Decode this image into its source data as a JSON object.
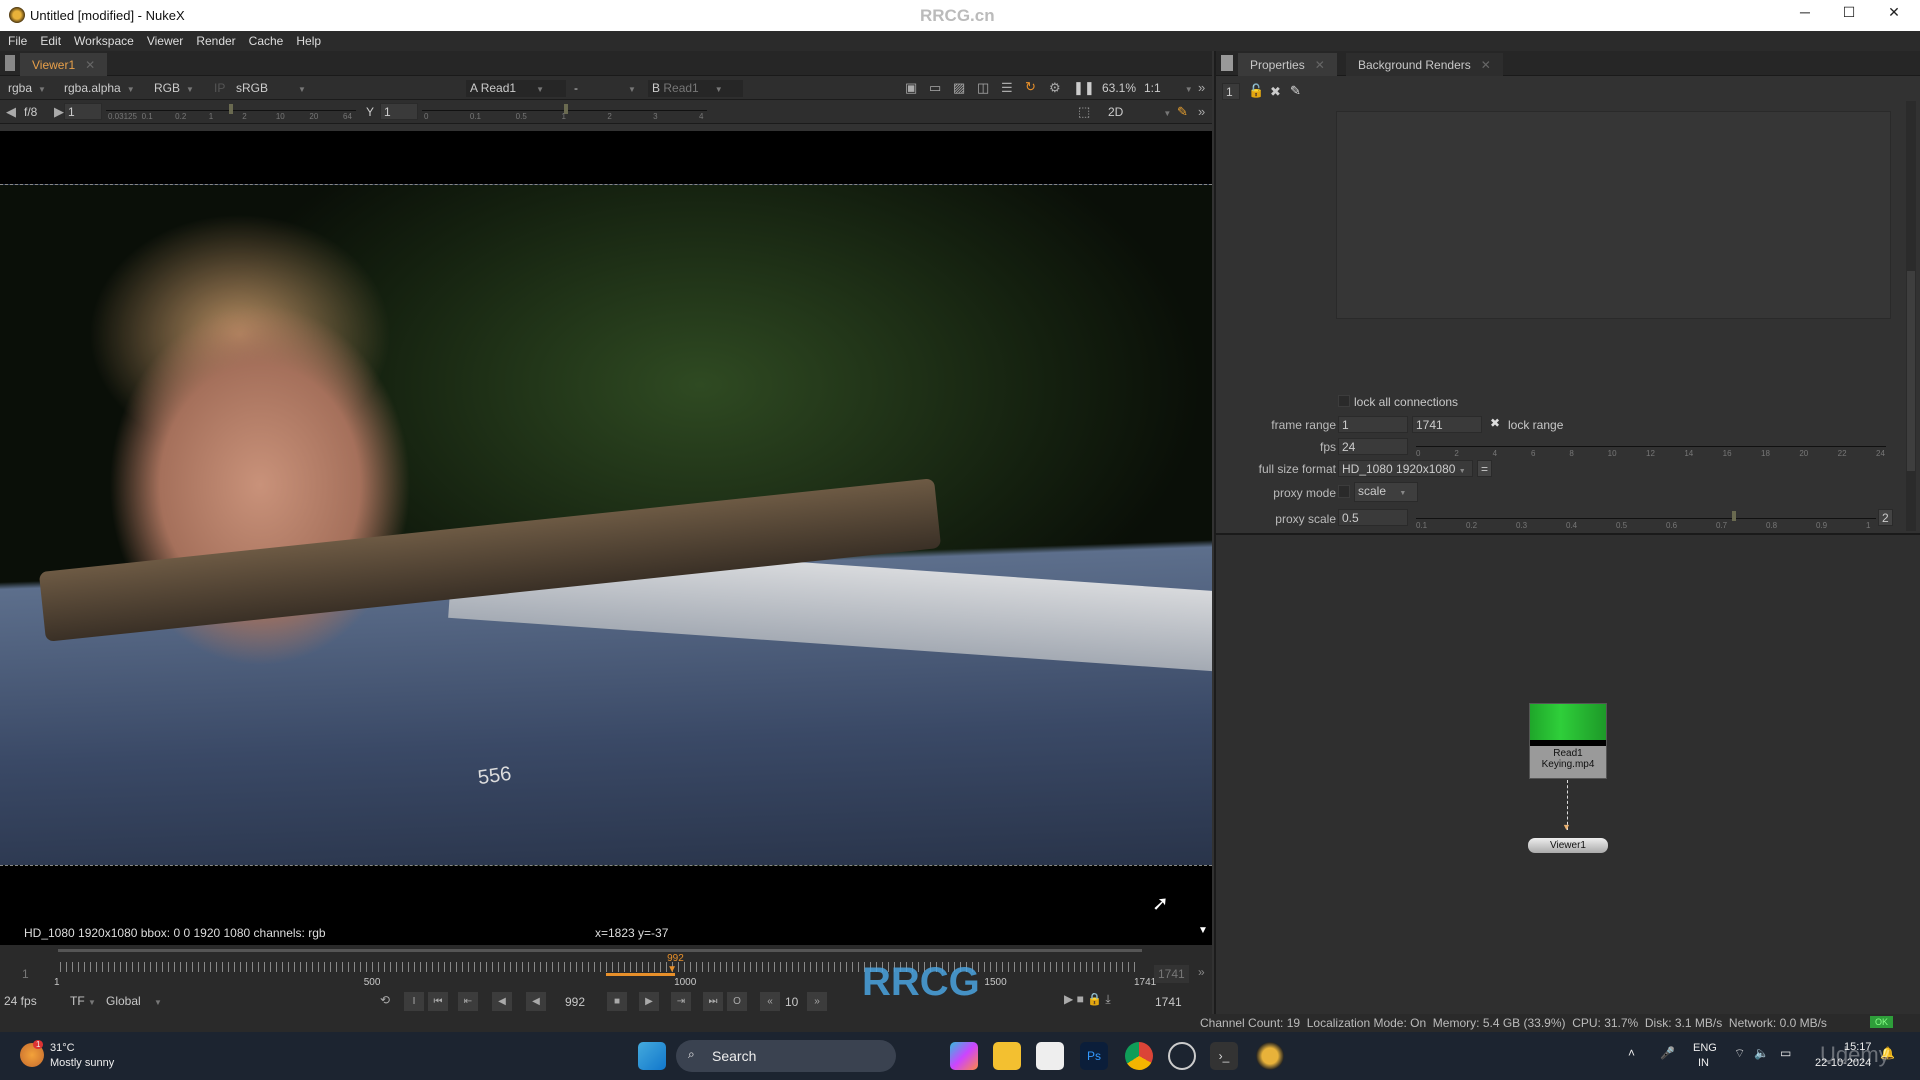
{
  "window": {
    "title": "Untitled [modified] - NukeX",
    "watermark": "RRCG.cn",
    "minimize": "─",
    "maximize": "☐",
    "close": "✕"
  },
  "menu": [
    "File",
    "Edit",
    "Workspace",
    "Viewer",
    "Render",
    "Cache",
    "Help"
  ],
  "viewer": {
    "tab": "Viewer1",
    "channels": "rgba",
    "alpha": "rgba.alpha",
    "display": "RGB",
    "ip": "IP",
    "lut": "sRGB",
    "a_label": "A",
    "a_input": "Read1",
    "op": "-",
    "b_label": "B",
    "b_input": "Read1",
    "zoom": "63.1%",
    "ratio": "1:1",
    "fstop": "f/8",
    "gain": "1",
    "gamma_label": "Y",
    "gamma": "1",
    "gain_ticks": [
      "0.03125",
      "0.1",
      "0.2",
      "1",
      "2",
      "10",
      "20",
      "64"
    ],
    "gamma_ticks": [
      "0",
      "0.1",
      "0.5",
      "1",
      "2",
      "3",
      "4"
    ],
    "mode": "2D",
    "info": "HD_1080 1920x1080  bbox: 0 0 1920 1080 channels: rgb",
    "coords": "x=1823 y=-37",
    "image_text": "556"
  },
  "timeline": {
    "start": "1",
    "end": "1741",
    "current": "992",
    "ticks": [
      "1",
      "500",
      "1000",
      "1500",
      "1741"
    ],
    "in_left": "1",
    "out_right": "1741",
    "range_start": 880,
    "range_end": 992
  },
  "playback": {
    "fps": "24 fps",
    "tf": "TF",
    "scope": "Global",
    "frame": "992",
    "step": "10",
    "end_frame": "1741",
    "in_label": "I",
    "out_label": "O"
  },
  "properties": {
    "tabs": [
      "Properties",
      "Background Renders"
    ],
    "max_panels": "1",
    "lock_all_connections": "lock all connections",
    "frame_range_label": "frame range",
    "frame_start": "1",
    "frame_end": "1741",
    "lock_range": "lock range",
    "lock_range_checked": true,
    "fps_label": "fps",
    "fps": "24",
    "fps_ticks": [
      "0",
      "2",
      "4",
      "6",
      "8",
      "10",
      "12",
      "14",
      "16",
      "18",
      "20",
      "22",
      "24"
    ],
    "format_label": "full size format",
    "format": "HD_1080 1920x1080",
    "format_eq": "=",
    "proxy_mode_label": "proxy mode",
    "proxy_mode": "scale",
    "proxy_scale_label": "proxy scale",
    "proxy_scale": "0.5",
    "proxy_ticks": [
      "0.1",
      "0.2",
      "0.3",
      "0.4",
      "0.5",
      "0.6",
      "0.7",
      "0.8",
      "0.9",
      "1"
    ],
    "proxy_btn": "2"
  },
  "nodegraph": {
    "read_node": {
      "name": "Read1",
      "file": "Keying.mp4"
    },
    "viewer_node": "Viewer1"
  },
  "status": {
    "text": "Channel Count: 19  Localization Mode: On  Memory: 5.4 GB (33.9%)  CPU: 31.7%  Disk: 3.1 MB/s  Network: 0.0 MB/s",
    "ok": "OK"
  },
  "taskbar": {
    "temp": "31°C",
    "weather": "Mostly sunny",
    "search": "Search",
    "lang1": "ENG",
    "lang2": "IN",
    "time": "15:17",
    "date": "22-10-2024",
    "badge": "1"
  },
  "watermarks": [
    "RRCG",
    "人人素材",
    "Udemy"
  ],
  "colors": {
    "accent": "#e8902a",
    "ok": "#2e9e3a",
    "tab_active": "#e8a04a"
  }
}
